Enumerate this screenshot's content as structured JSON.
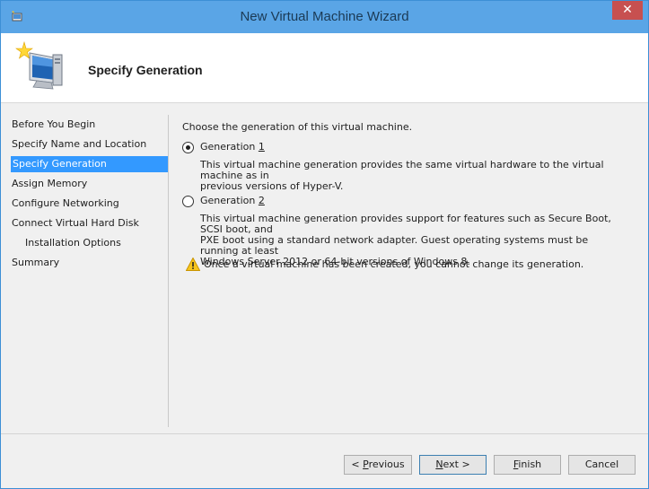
{
  "window": {
    "title": "New Virtual Machine Wizard",
    "close_glyph": "✕"
  },
  "header": {
    "heading": "Specify Generation",
    "icon": "wizard-computer-icon"
  },
  "sidebar": {
    "items": [
      {
        "label": "Before You Begin",
        "active": false,
        "sub": false
      },
      {
        "label": "Specify Name and Location",
        "active": false,
        "sub": false
      },
      {
        "label": "Specify Generation",
        "active": true,
        "sub": false
      },
      {
        "label": "Assign Memory",
        "active": false,
        "sub": false
      },
      {
        "label": "Configure Networking",
        "active": false,
        "sub": false
      },
      {
        "label": "Connect Virtual Hard Disk",
        "active": false,
        "sub": false
      },
      {
        "label": "Installation Options",
        "active": false,
        "sub": true
      },
      {
        "label": "Summary",
        "active": false,
        "sub": false
      }
    ]
  },
  "content": {
    "intro": "Choose the generation of this virtual machine.",
    "gen1": {
      "label_prefix": "Generation ",
      "label_key": "1",
      "selected": true,
      "description_line1": "This virtual machine generation provides the same virtual hardware to the virtual machine as in",
      "description_line2": "previous versions of Hyper-V."
    },
    "gen2": {
      "label_prefix": "Generation ",
      "label_key": "2",
      "selected": false,
      "description_line1": "This virtual machine generation provides support for features such as Secure Boot, SCSI boot, and",
      "description_line2": "PXE boot using a standard network adapter. Guest operating systems must be running at least",
      "description_line3": "Windows Server 2012 or 64-bit versions of Windows 8."
    },
    "warning": "Once a virtual machine has been created, you cannot change its generation."
  },
  "buttons": {
    "previous_prefix": "< ",
    "previous_key": "P",
    "previous_rest": "revious",
    "next_key": "N",
    "next_rest": "ext >",
    "finish_key": "F",
    "finish_rest": "inish",
    "cancel": "Cancel"
  },
  "colors": {
    "accent": "#3399ff",
    "titlebar": "#5aa5e6",
    "close": "#c75050"
  }
}
